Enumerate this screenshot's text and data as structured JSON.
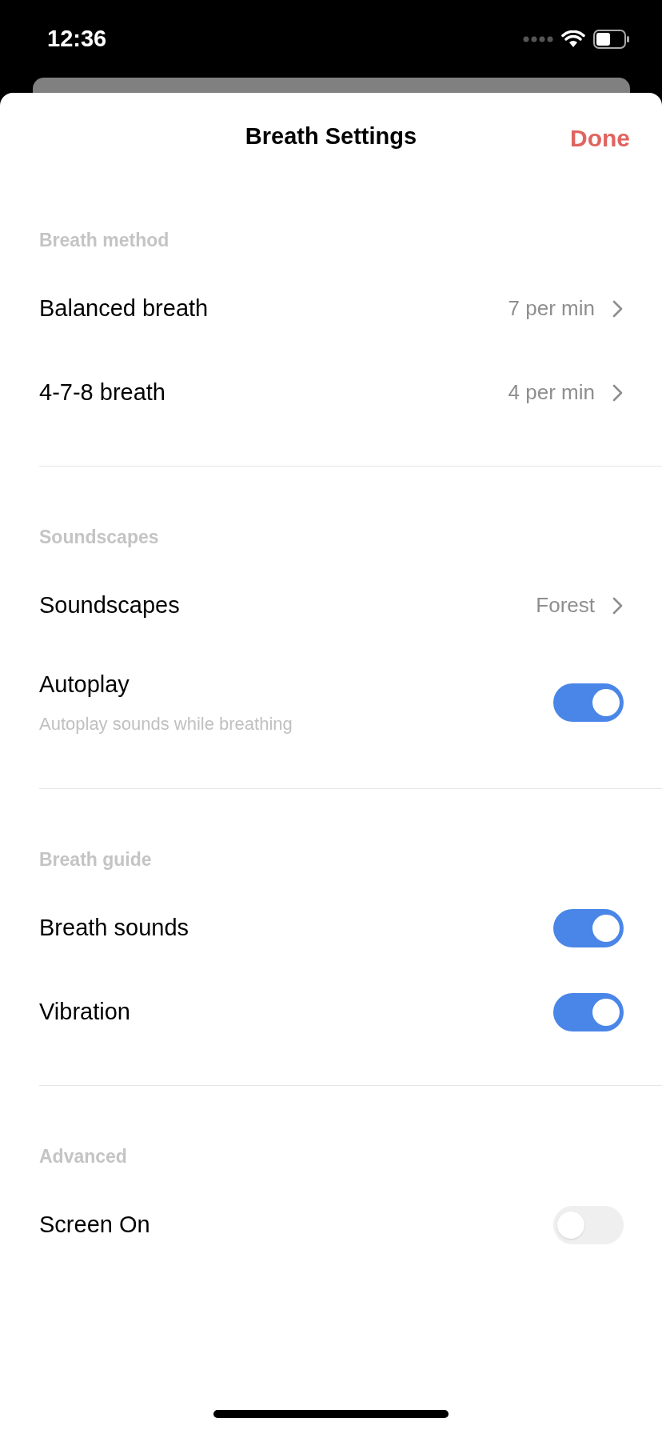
{
  "status_bar": {
    "time": "12:36"
  },
  "header": {
    "title": "Breath Settings",
    "done": "Done"
  },
  "sections": [
    {
      "title": "Breath method",
      "rows": [
        {
          "kind": "link",
          "label": "Balanced breath",
          "value": "7 per min"
        },
        {
          "kind": "link",
          "label": "4-7-8 breath",
          "value": "4 per min"
        }
      ]
    },
    {
      "title": "Soundscapes",
      "rows": [
        {
          "kind": "link",
          "label": "Soundscapes",
          "value": "Forest"
        },
        {
          "kind": "toggle",
          "label": "Autoplay",
          "subtitle": "Autoplay sounds while breathing",
          "on": true
        }
      ]
    },
    {
      "title": "Breath guide",
      "rows": [
        {
          "kind": "toggle",
          "label": "Breath sounds",
          "on": true
        },
        {
          "kind": "toggle",
          "label": "Vibration",
          "on": true
        }
      ]
    },
    {
      "title": "Advanced",
      "rows": [
        {
          "kind": "toggle",
          "label": "Screen On",
          "on": false
        }
      ]
    }
  ]
}
